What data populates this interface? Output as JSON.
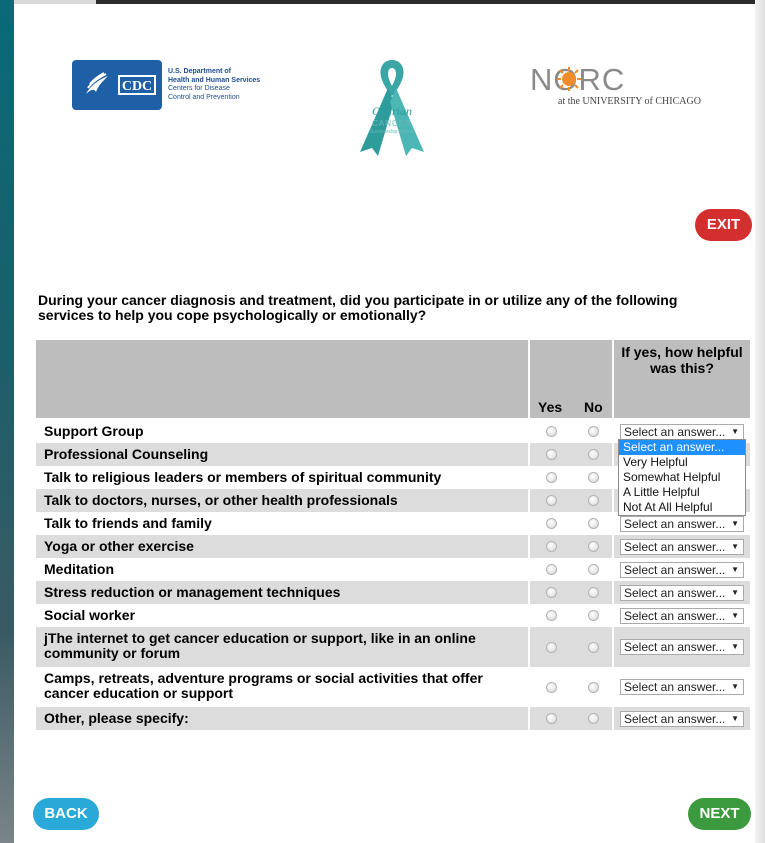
{
  "logos": {
    "cdc_box_text": "CDC",
    "hhs_lines": [
      "U.S. Department of",
      "Health and Human Services",
      "Centers for Disease",
      "Control and Prevention"
    ],
    "ribbon_title": "Ovarian",
    "ribbon_sub1": "CANCER",
    "ribbon_sub2": "Survivorship Survey",
    "norc_word": "NORC",
    "norc_sub": "at the UNIVERSITY of CHICAGO"
  },
  "buttons": {
    "exit": "EXIT",
    "back": "BACK",
    "next": "NEXT"
  },
  "question": "During your cancer diagnosis and treatment, did you participate in or utilize any of the following services to help you cope psychologically or emotionally?",
  "table": {
    "helpful_header": "If yes, how helpful was this?",
    "yes_header": "Yes",
    "no_header": "No",
    "select_placeholder": "Select an answer...",
    "rows": [
      "Support Group",
      "Professional Counseling",
      "Talk to religious leaders or members of spiritual community",
      "Talk to doctors, nurses, or other health professionals",
      "Talk to friends and family",
      "Yoga or other exercise",
      "Meditation",
      "Stress reduction or management techniques",
      "Social worker",
      "jThe internet to get cancer education or support, like in an online community or forum",
      "Camps, retreats, adventure programs or social activities that offer cancer education or support",
      "Other, please specify:"
    ]
  },
  "dropdown": {
    "options": [
      "Select an answer...",
      "Very Helpful",
      "Somewhat Helpful",
      "A Little Helpful",
      "Not At All Helpful"
    ],
    "highlighted_index": 0
  },
  "colors": {
    "exit": "#d32f2f",
    "back": "#29a9d8",
    "next": "#3c9a3e",
    "teal": "#2a9ea1"
  }
}
